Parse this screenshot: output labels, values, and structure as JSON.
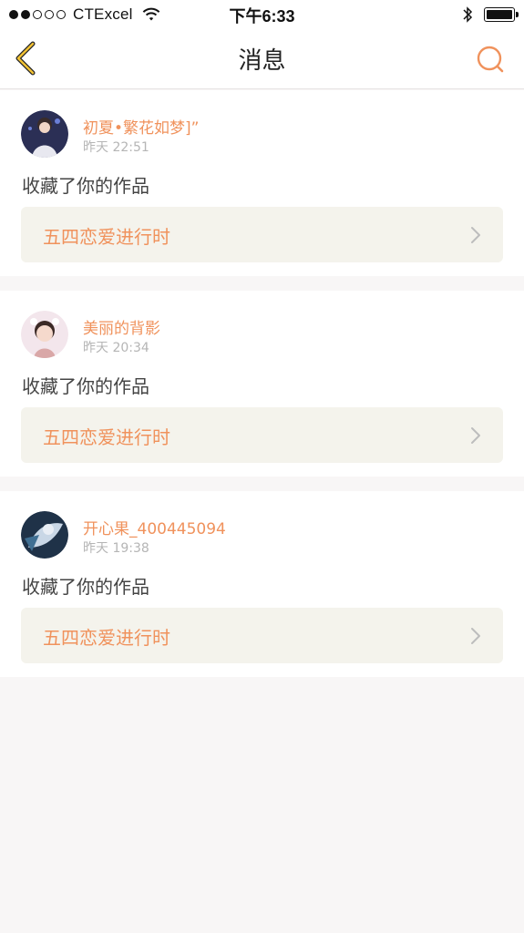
{
  "status_bar": {
    "carrier": "CTExcel",
    "time": "下午6:33",
    "signal_bars": 2,
    "signal_total": 5
  },
  "nav": {
    "title": "消息",
    "accent_color": "#f0925c"
  },
  "messages": [
    {
      "username": "初夏•繁花如梦]”",
      "time": "昨天 22:51",
      "action": "收藏了你的作品",
      "work_title": "五四恋爱进行时",
      "avatar_colors": [
        "#2b2f55",
        "#e8e8f0"
      ]
    },
    {
      "username": "美丽的背影",
      "time": "昨天 20:34",
      "action": "收藏了你的作品",
      "work_title": "五四恋爱进行时",
      "avatar_colors": [
        "#f3e6ec",
        "#d9a7a7"
      ]
    },
    {
      "username": "开心果_400445094",
      "time": "昨天 19:38",
      "action": "收藏了你的作品",
      "work_title": "五四恋爱进行时",
      "avatar_colors": [
        "#1f3248",
        "#c9d7e6"
      ]
    }
  ]
}
